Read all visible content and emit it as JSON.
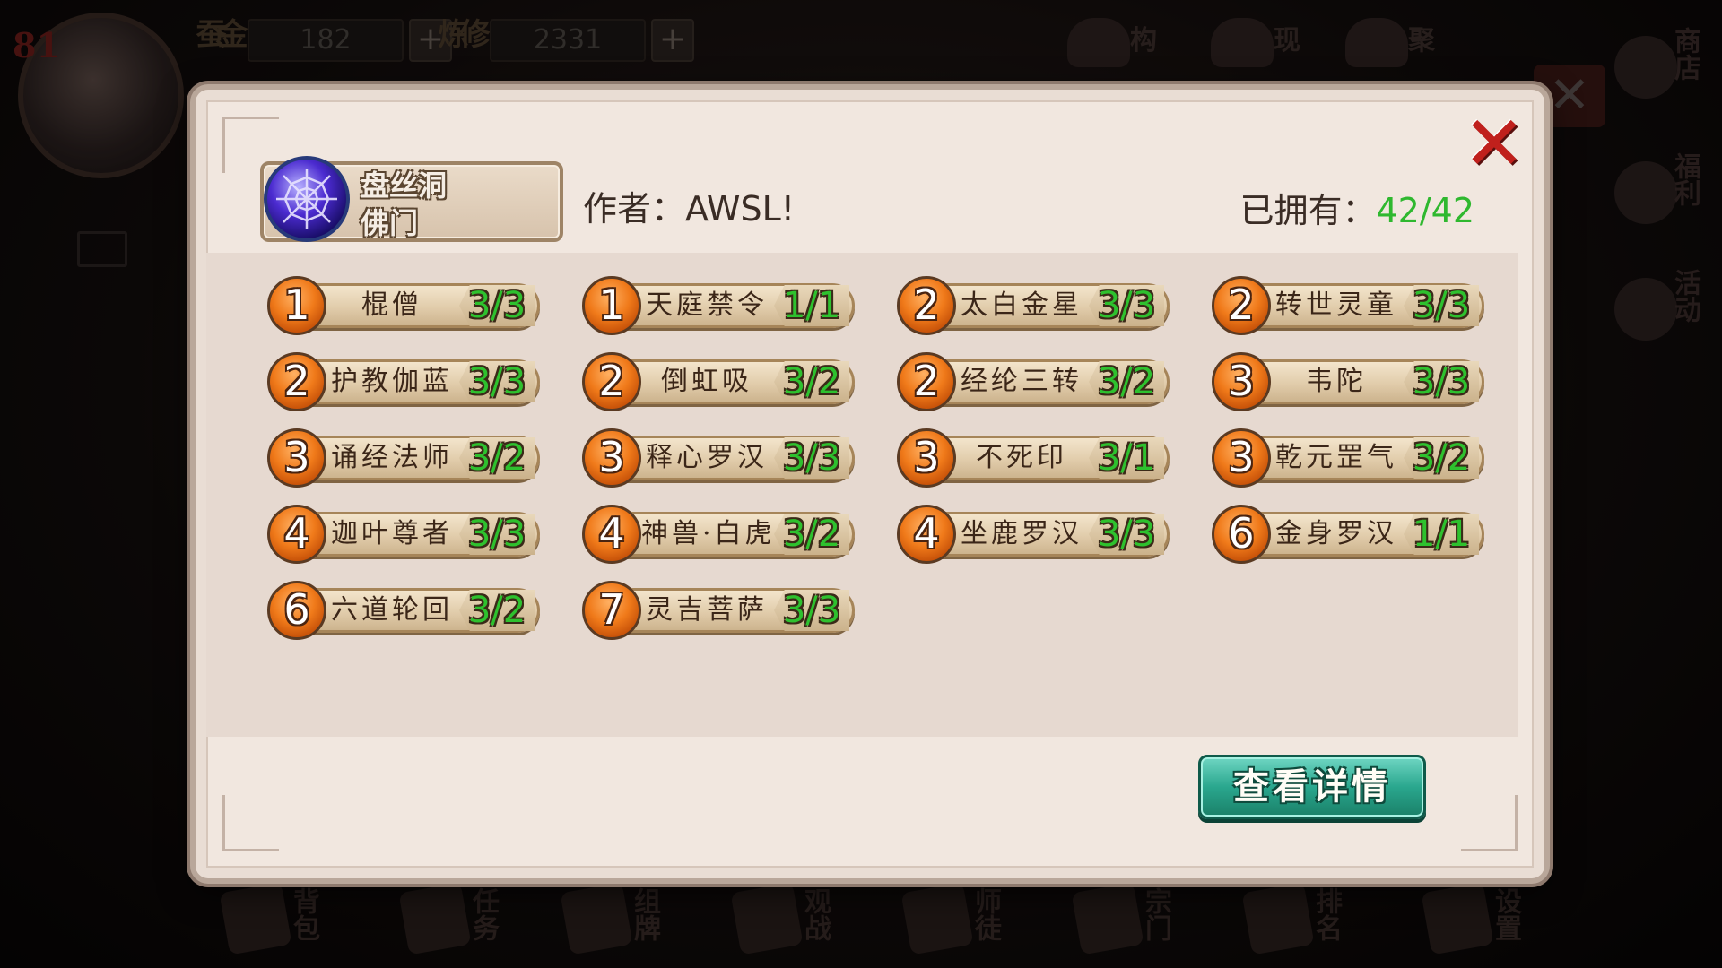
{
  "background": {
    "level": "81",
    "resources": [
      {
        "label": "金蚕",
        "value": "182"
      },
      {
        "label": "修炼",
        "value": "2331"
      }
    ],
    "top_icons": [
      "构",
      "现",
      "聚",
      "商店"
    ],
    "side_icons": [
      "福利",
      "活动"
    ],
    "bottom_icons": [
      "背包",
      "任务",
      "组牌",
      "观战",
      "师徒",
      "宗门",
      "排名",
      "设置"
    ]
  },
  "dialog": {
    "deck_name": "盘丝洞",
    "faction": "佛门",
    "author": "作者：AWSL!",
    "owned_label": "已拥有：",
    "owned_value": "42/42",
    "details_button": "查看详情",
    "close_icon": "close-x-icon"
  },
  "cards": [
    {
      "cost": "1",
      "name": "棍僧",
      "count": "3/3"
    },
    {
      "cost": "1",
      "name": "天庭禁令",
      "count": "1/1"
    },
    {
      "cost": "2",
      "name": "太白金星",
      "count": "3/3"
    },
    {
      "cost": "2",
      "name": "转世灵童",
      "count": "3/3"
    },
    {
      "cost": "2",
      "name": "护教伽蓝",
      "count": "3/3"
    },
    {
      "cost": "2",
      "name": "倒虹吸",
      "count": "3/2"
    },
    {
      "cost": "2",
      "name": "经纶三转",
      "count": "3/2"
    },
    {
      "cost": "3",
      "name": "韦陀",
      "count": "3/3"
    },
    {
      "cost": "3",
      "name": "诵经法师",
      "count": "3/2"
    },
    {
      "cost": "3",
      "name": "释心罗汉",
      "count": "3/3"
    },
    {
      "cost": "3",
      "name": "不死印",
      "count": "3/1"
    },
    {
      "cost": "3",
      "name": "乾元罡气",
      "count": "3/2"
    },
    {
      "cost": "4",
      "name": "迦叶尊者",
      "count": "3/3"
    },
    {
      "cost": "4",
      "name": "神兽·白虎",
      "count": "3/2"
    },
    {
      "cost": "4",
      "name": "坐鹿罗汉",
      "count": "3/3"
    },
    {
      "cost": "6",
      "name": "金身罗汉",
      "count": "1/1"
    },
    {
      "cost": "6",
      "name": "六道轮回",
      "count": "3/2"
    },
    {
      "cost": "7",
      "name": "灵吉菩萨",
      "count": "3/3"
    }
  ],
  "colors": {
    "count_green": "#2ec12e",
    "cost_orange": "#f07a1a",
    "button_teal": "#2aa78e",
    "close_red": "#c0201c"
  }
}
